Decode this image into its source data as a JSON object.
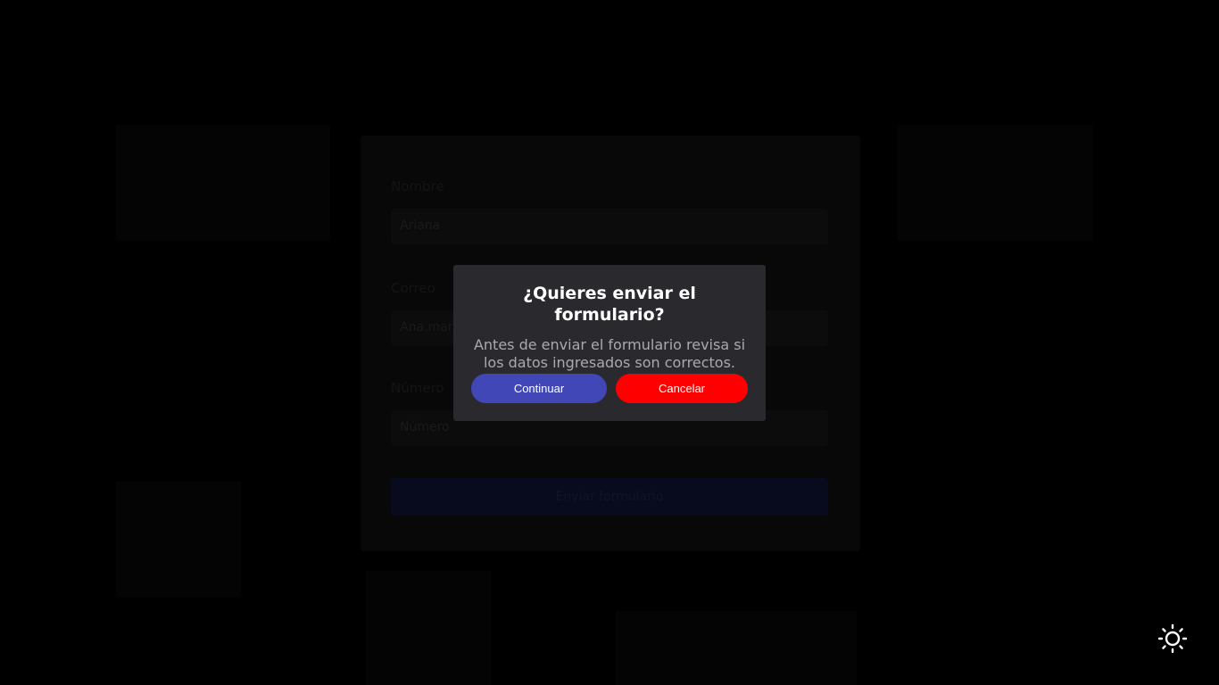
{
  "form": {
    "fields": [
      {
        "label": "Nombre",
        "placeholder": "Ariana"
      },
      {
        "label": "Correo",
        "placeholder": "Ana.mar"
      },
      {
        "label": "Número",
        "placeholder": "Número"
      }
    ],
    "submit_label": "Enviar formulario"
  },
  "modal": {
    "title": "¿Quieres enviar el formulario?",
    "text": "Antes de enviar el formulario revisa si los datos ingresados son correctos.",
    "continue_label": "Continuar",
    "cancel_label": "Cancelar"
  },
  "colors": {
    "continue_button": "#4247b8",
    "cancel_button": "#ff0000",
    "modal_background": "#2a2a2e",
    "overlay": "#000000"
  },
  "theme_toggle": {
    "icon": "sun-icon"
  }
}
